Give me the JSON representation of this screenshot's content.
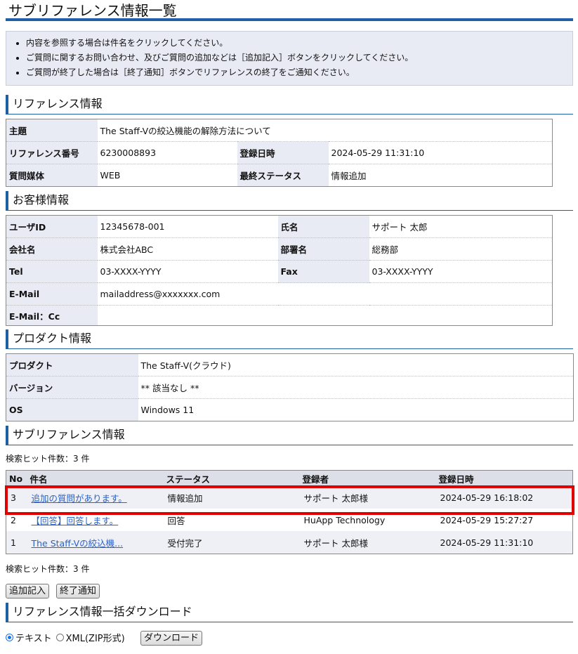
{
  "page": {
    "title": "サブリファレンス情報一覧",
    "notes": [
      "内容を参照する場合は件名をクリックしてください。",
      "ご質問に関するお問い合わせ、及びご質問の追加などは［追加記入］ボタンをクリックしてください。",
      "ご質問が終了した場合は［終了通知］ボタンでリファレンスの終了をご通知ください。"
    ]
  },
  "reference": {
    "heading": "リファレンス情報",
    "subject_label": "主題",
    "subject_value": "The Staff-Vの絞込機能の解除方法について",
    "number_label": "リファレンス番号",
    "number_value": "6230008893",
    "registered_label": "登録日時",
    "registered_value": "2024-05-29 11:31:10",
    "medium_label": "質問媒体",
    "medium_value": "WEB",
    "status_label": "最終ステータス",
    "status_value": "情報追加"
  },
  "customer": {
    "heading": "お客様情報",
    "userid_label": "ユーザID",
    "userid_value": "12345678-001",
    "name_label": "氏名",
    "name_value": "サポート 太郎",
    "company_label": "会社名",
    "company_value": "株式会社ABC",
    "dept_label": "部署名",
    "dept_value": "総務部",
    "tel_label": "Tel",
    "tel_value": "03-XXXX-YYYY",
    "fax_label": "Fax",
    "fax_value": "03-XXXX-YYYY",
    "email_label": "E-Mail",
    "email_value": "mailaddress@xxxxxxx.com",
    "emailcc_label": "E-Mail：Cc",
    "emailcc_value": ""
  },
  "product": {
    "heading": "プロダクト情報",
    "product_label": "プロダクト",
    "product_value": "The Staff-V(クラウド)",
    "version_label": "バージョン",
    "version_value": "** 該当なし **",
    "os_label": "OS",
    "os_value": "Windows 11"
  },
  "sub": {
    "heading": "サブリファレンス情報",
    "count_text": "検索ヒット件数：3 件",
    "headers": {
      "no": "No",
      "subject": "件名",
      "status": "ステータス",
      "author": "登録者",
      "date": "登録日時"
    },
    "rows": [
      {
        "no": "3",
        "subject": "追加の質問があります。",
        "status": "情報追加",
        "author": "サポート 太郎様",
        "date": "2024-05-29 16:18:02"
      },
      {
        "no": "2",
        "subject": "【回答】回答します。",
        "status": "回答",
        "author": "HuApp Technology",
        "date": "2024-05-29 15:27:27"
      },
      {
        "no": "1",
        "subject": "The Staff-Vの絞込機...",
        "status": "受付完了",
        "author": "サポート 太郎様",
        "date": "2024-05-29 11:31:10"
      }
    ]
  },
  "actions": {
    "add_label": "追加記入",
    "end_label": "終了通知"
  },
  "download": {
    "heading": "リファレンス情報一括ダウンロード",
    "option_text": "テキスト",
    "option_xml": "XML(ZIP形式)",
    "button_label": "ダウンロード",
    "selected": "テキスト"
  },
  "colors": {
    "accent": "#1f5fa3",
    "highlight": "#e00000",
    "link": "#2a62c9"
  }
}
